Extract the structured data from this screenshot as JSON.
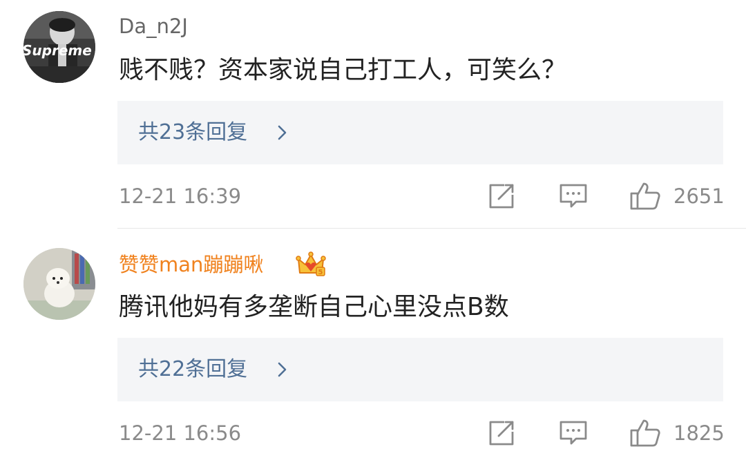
{
  "comments": [
    {
      "username": "Da_n2J",
      "avatar_text": "Supreme",
      "text": "贱不贱？资本家说自己打工人，可笑么？",
      "replies_label": "共23条回复",
      "timestamp": "12-21 16:39",
      "like_count": "2651",
      "username_color": "#666666"
    },
    {
      "username": "赞赞man蹦蹦啾",
      "badge_icon": "crown-badge-icon",
      "text": "腾讯他妈有多垄断自己心里没点B数",
      "replies_label": "共22条回复",
      "timestamp": "12-21 16:56",
      "like_count": "1825",
      "username_color": "#f0821e"
    }
  ],
  "colors": {
    "reply_link": "#4f6f95",
    "reply_bg": "#f4f5f7",
    "meta_text": "#8a8a8a"
  },
  "icons": {
    "repost": "share-square-icon",
    "comment": "comment-bubble-icon",
    "like": "thumbs-up-icon",
    "chevron": "chevron-right-icon"
  }
}
